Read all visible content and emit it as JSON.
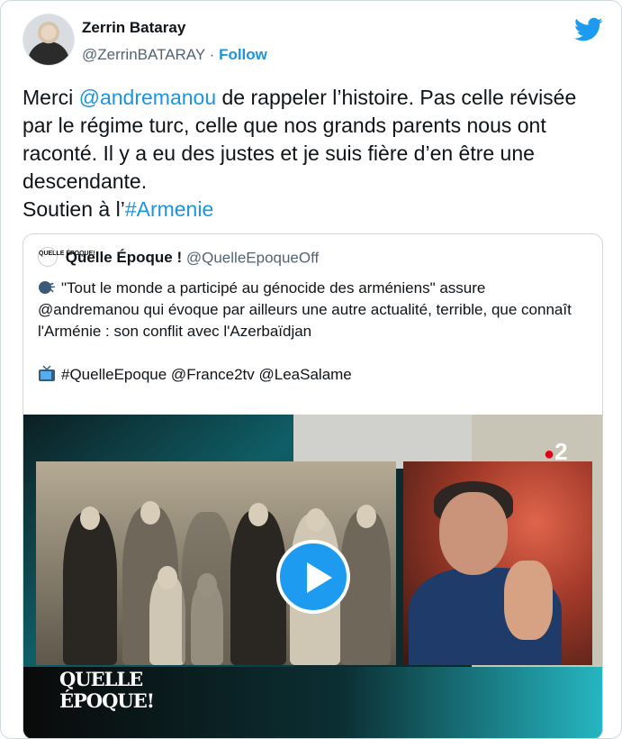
{
  "author": {
    "name": "Zerrin Bataray",
    "handle": "@ZerrinBATARAY",
    "separator": "·",
    "follow_label": "Follow"
  },
  "tweet": {
    "t1": "Merci ",
    "mention": "@andremanou",
    "t2": " de rappeler l’histoire. Pas celle révisée par le régime turc, celle que nos grands parents nous ont raconté. Il y a eu des justes et je suis fière d’en être une descendante.",
    "t3": "Soutien à l’",
    "hashtag": "#Armenie"
  },
  "quoted": {
    "avatar_text": "QUELLE ÉPOQUE!",
    "name": "Quelle Époque !",
    "handle": "@QuelleEpoqueOff",
    "emoji1": "speaking-head",
    "line1": "\"Tout le monde a participé au génocide des arméniens\" assure @andremanou qui évoque par ailleurs une autre actualité, terrible, que connaît l'Arménie : son conflit avec l'Azerbaïdjan",
    "emoji2": "television",
    "line2": "#QuelleEpoque @France2tv @LeaSalame"
  },
  "media": {
    "channel_logo_num": "2",
    "channel_logo_dot": "●",
    "show_logo_l1": "QUELLE",
    "show_logo_l2": "ÉPOQUE!"
  },
  "colors": {
    "link": "#1b95e0",
    "play": "#1d9bf0",
    "border": "#cfd9de"
  }
}
